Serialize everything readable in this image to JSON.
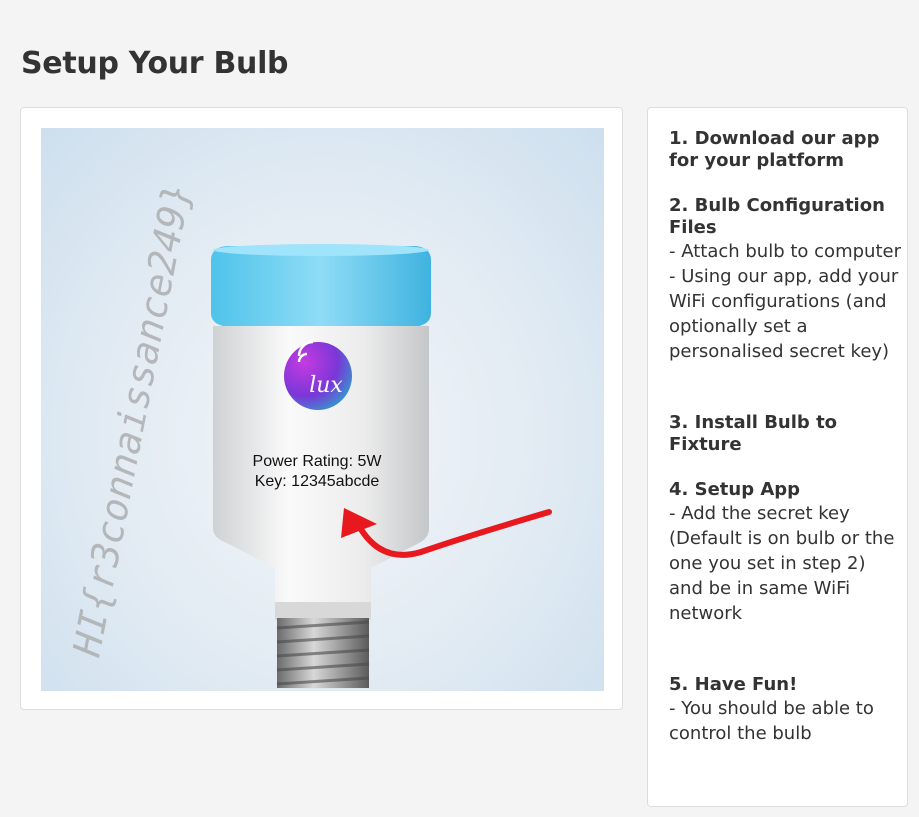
{
  "page": {
    "title": "Setup Your Bulb"
  },
  "image": {
    "watermark": "HI{r3connaissance249}",
    "logo_text": "lux",
    "label_line1": "Power Rating: 5W",
    "label_line2": "Key: 12345abcde",
    "arrow_color": "#e8191e"
  },
  "steps": [
    {
      "heading": "1. Download our app for your platform",
      "lines": []
    },
    {
      "heading": "2. Bulb Configuration Files",
      "lines": [
        "- Attach bulb to computer",
        "- Using our app, add your WiFi configurations (and optionally set a personalised secret key)"
      ]
    },
    {
      "heading": "3. Install Bulb to Fixture",
      "lines": []
    },
    {
      "heading": "4. Setup App",
      "lines": [
        "- Add the secret key (Default is on bulb or the one you set in step 2) and be in same WiFi network"
      ]
    },
    {
      "heading": "5. Have Fun!",
      "lines": [
        "- You should be able to control the bulb"
      ]
    }
  ]
}
